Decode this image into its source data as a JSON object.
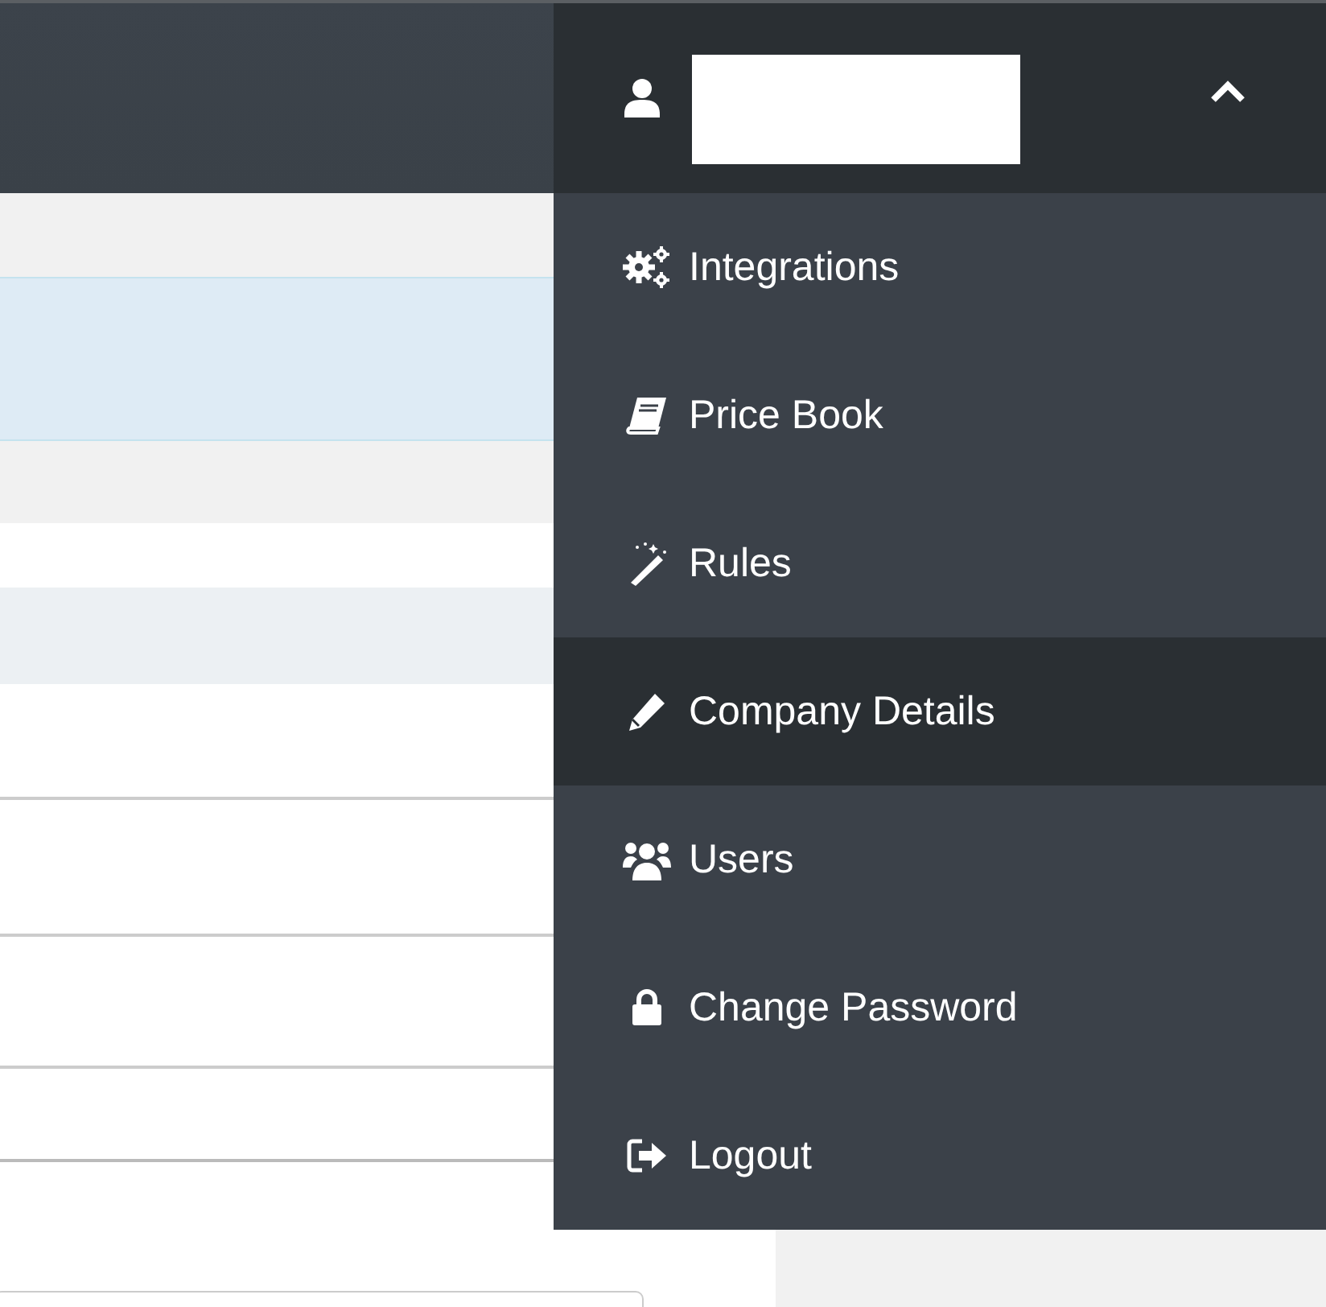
{
  "user_menu": {
    "expanded": true,
    "items": [
      {
        "label": "Integrations",
        "kind": "gears",
        "selected": false
      },
      {
        "label": "Price Book",
        "kind": "book",
        "selected": false
      },
      {
        "label": "Rules",
        "kind": "wand",
        "selected": false
      },
      {
        "label": "Company Details",
        "kind": "pencil",
        "selected": true
      },
      {
        "label": "Users",
        "kind": "group",
        "selected": false
      },
      {
        "label": "Change Password",
        "kind": "lock",
        "selected": false
      },
      {
        "label": "Logout",
        "kind": "exit",
        "selected": false
      }
    ]
  }
}
